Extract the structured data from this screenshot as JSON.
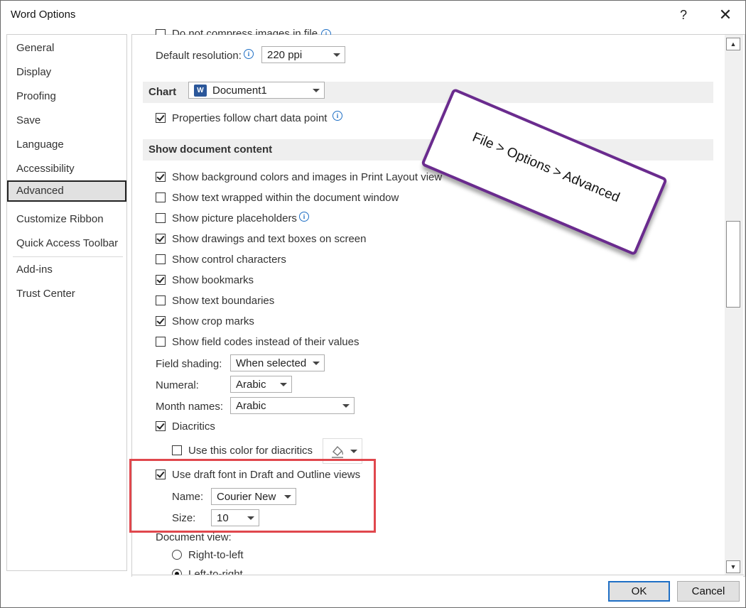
{
  "window": {
    "title": "Word Options",
    "help_glyph": "?",
    "close_glyph": "✕"
  },
  "sidebar": {
    "items": [
      {
        "label": "General"
      },
      {
        "label": "Display"
      },
      {
        "label": "Proofing"
      },
      {
        "label": "Save"
      },
      {
        "label": "Language"
      },
      {
        "label": "Accessibility"
      },
      {
        "label": "Advanced",
        "selected": true
      },
      {
        "label": "Customize Ribbon"
      },
      {
        "label": "Quick Access Toolbar"
      },
      {
        "label": "Add-ins"
      },
      {
        "label": "Trust Center"
      }
    ]
  },
  "content": {
    "image_size": {
      "compress_label": "Do not compress images in file",
      "compress_checked": false,
      "resolution_label": "Default resolution:",
      "resolution_value": "220 ppi"
    },
    "chart": {
      "header": "Chart",
      "document_value": "Document1",
      "doc_icon_text": "W",
      "properties_label": "Properties follow chart data point",
      "properties_checked": true
    },
    "show_document_content": {
      "header": "Show document content",
      "options": [
        {
          "label": "Show background colors and images in Print Layout view",
          "checked": true
        },
        {
          "label": "Show text wrapped within the document window",
          "checked": false
        },
        {
          "label": "Show picture placeholders",
          "checked": false
        },
        {
          "label": "Show drawings and text boxes on screen",
          "checked": true
        },
        {
          "label": "Show control characters",
          "checked": false
        },
        {
          "label": "Show bookmarks",
          "checked": true
        },
        {
          "label": "Show text boundaries",
          "checked": false
        },
        {
          "label": "Show crop marks",
          "checked": true
        },
        {
          "label": "Show field codes instead of their values",
          "checked": false
        }
      ],
      "field_shading": {
        "label": "Field shading:",
        "value": "When selected"
      },
      "numeral": {
        "label": "Numeral:",
        "value": "Arabic"
      },
      "month_names": {
        "label": "Month names:",
        "value": "Arabic"
      },
      "diacritics": {
        "label": "Diacritics",
        "checked": true
      },
      "diacritics_color": {
        "label": "Use this color for diacritics",
        "checked": false
      },
      "draft_font": {
        "label": "Use draft font in Draft and Outline views",
        "checked": true
      },
      "font_name": {
        "label": "Name:",
        "value": "Courier New"
      },
      "font_size": {
        "label": "Size:",
        "value": "10"
      },
      "document_view": {
        "label": "Document view:",
        "options": [
          {
            "label": "Right-to-left",
            "selected": false
          },
          {
            "label": "Left-to-right",
            "selected": true
          }
        ]
      }
    }
  },
  "callout": {
    "text": "File > Options > Advanced"
  },
  "footer": {
    "ok_label": "OK",
    "cancel_label": "Cancel"
  },
  "colors": {
    "callout_border": "#6a2b8e",
    "highlight_box": "#e0474d",
    "ok_border": "#1f6fc5"
  }
}
